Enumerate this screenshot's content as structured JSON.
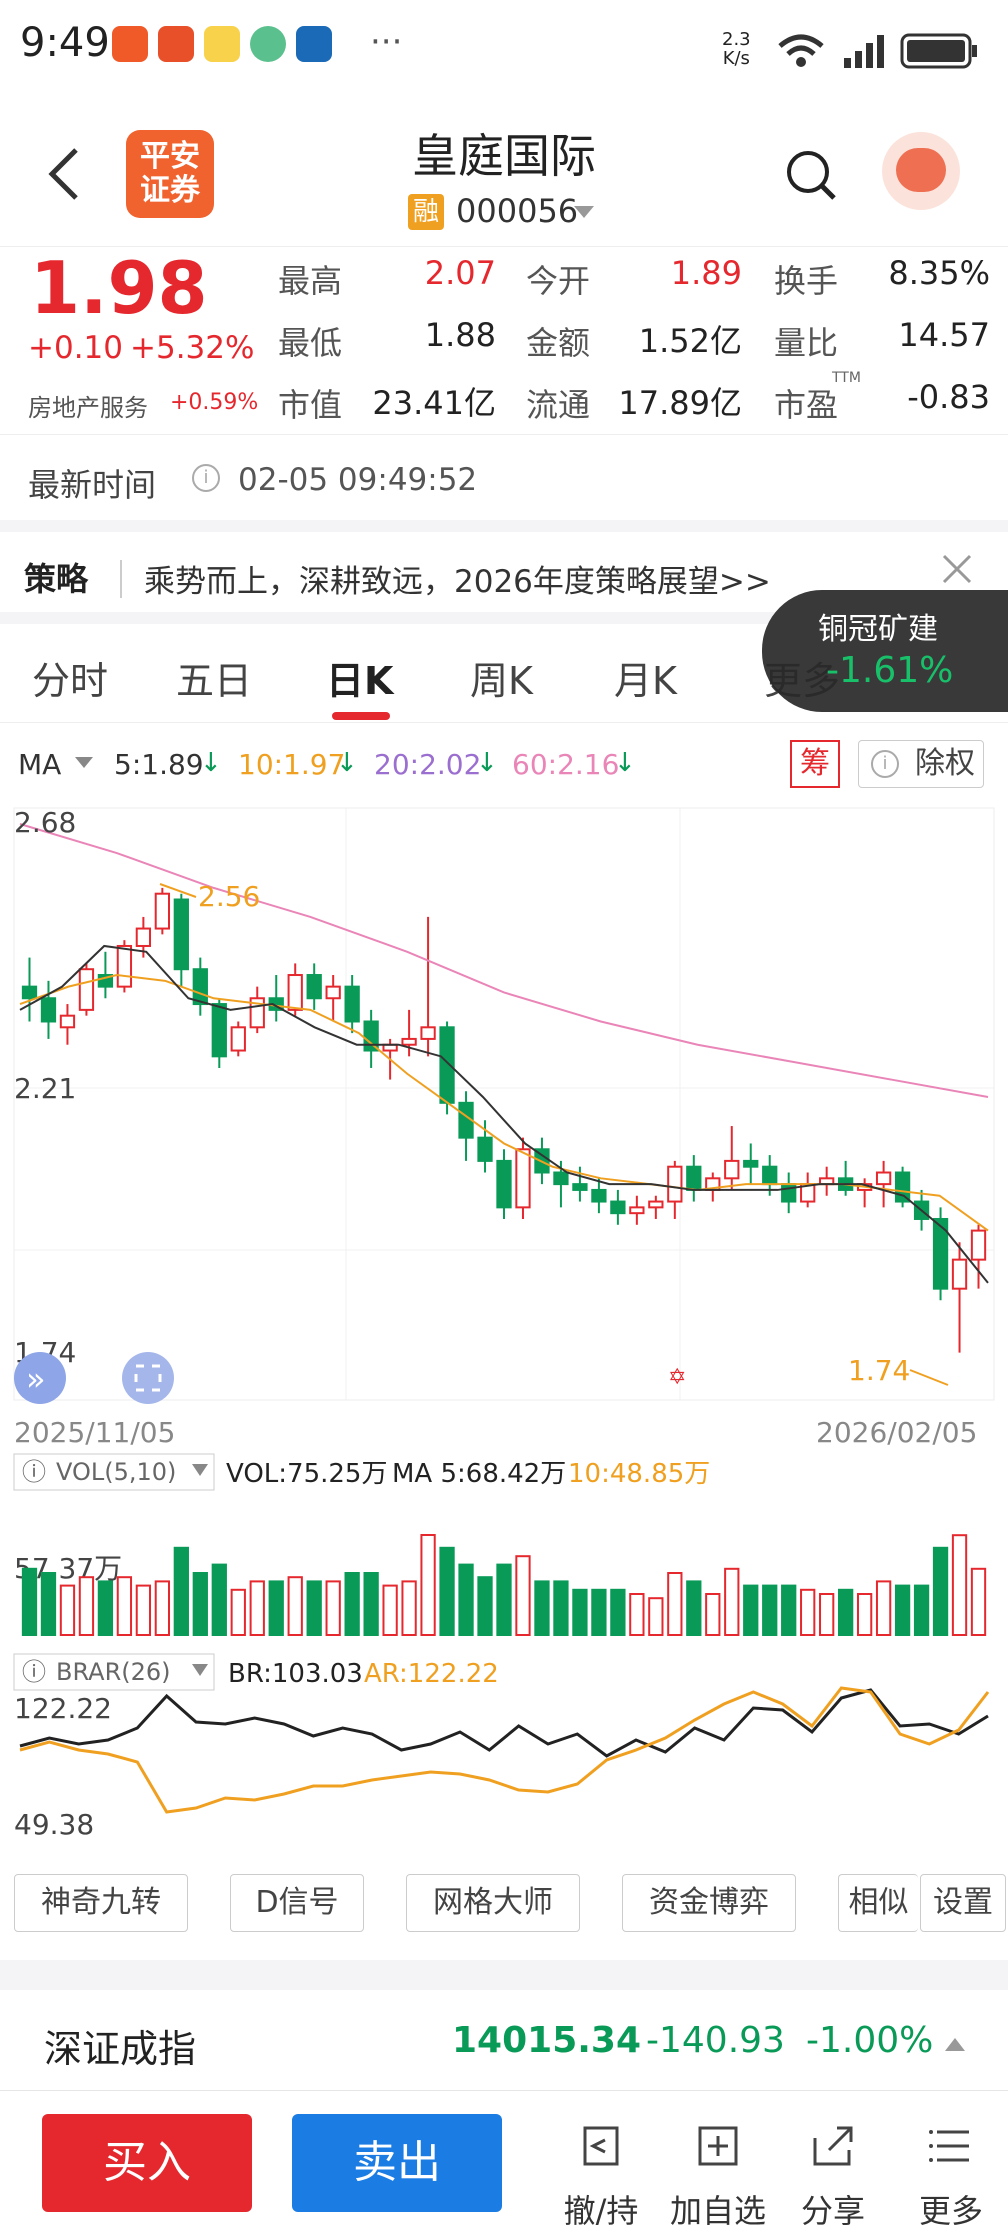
{
  "status": {
    "time": "9:49",
    "net_speed": "2.3\nK/s",
    "more": "···"
  },
  "header": {
    "title": "皇庭国际",
    "margin_badge": "融",
    "code": "000056",
    "broker_logo": "平安\n证券"
  },
  "quote": {
    "price": "1.98",
    "change": "+0.10",
    "change_pct": "+5.32%",
    "sector": "房地产服务",
    "sector_change": "+0.59%",
    "fields": [
      {
        "label": "最高",
        "value": "2.07",
        "color": "red"
      },
      {
        "label": "今开",
        "value": "1.89",
        "color": "red"
      },
      {
        "label": "换手",
        "value": "8.35%",
        "color": "dark"
      },
      {
        "label": "最低",
        "value": "1.88",
        "color": "dark"
      },
      {
        "label": "金额",
        "value": "1.52亿",
        "color": "dark"
      },
      {
        "label": "量比",
        "value": "14.57",
        "color": "dark"
      },
      {
        "label": "市值",
        "value": "23.41亿",
        "color": "dark"
      },
      {
        "label": "流通",
        "value": "17.89亿",
        "color": "dark"
      },
      {
        "label": "市盈",
        "value": "-0.83",
        "color": "dark"
      }
    ],
    "ttm": "TTM"
  },
  "latest_time": {
    "label": "最新时间",
    "value": "02-05 09:49:52"
  },
  "strategy": {
    "label": "策略",
    "text": "乘势而上，深耕致远，2026年度策略展望>>"
  },
  "popup": {
    "name": "铜冠矿建",
    "change": "-1.61%"
  },
  "tabs": [
    "分时",
    "五日",
    "日K",
    "周K",
    "月K",
    "更多"
  ],
  "ma_legend": {
    "label": "MA",
    "ma5": "5:1.89",
    "ma10": "10:1.97",
    "ma20": "20:2.02",
    "ma60": "60:2.16",
    "chip": "筹",
    "exright": "除权"
  },
  "kchart": {
    "y_top": "2.68",
    "y_mid": "2.21",
    "y_bot": "1.74",
    "hi_label": "2.56",
    "lo_label": "1.74",
    "date_start": "2025/11/05",
    "date_end": "2026/02/05"
  },
  "vol": {
    "title": "VOL(5,10)",
    "vol": "VOL:75.25万",
    "ma5": "MA 5:68.42万",
    "ma10": "10:48.85万",
    "axis": "57.37万"
  },
  "brar": {
    "title": "BRAR(26)",
    "br": "BR:103.03",
    "ar": "AR:122.22",
    "axis_top": "122.22",
    "axis_bot": "49.38"
  },
  "tools": [
    "神奇九转",
    "D信号",
    "网格大师",
    "资金博弈",
    "相似",
    "设置"
  ],
  "index": {
    "name": "深证成指",
    "value": "14015.34",
    "change": "-140.93",
    "pct": "-1.00%"
  },
  "bottom": {
    "buy": "买入",
    "sell": "卖出",
    "cancel": "撤/持",
    "add": "加自选",
    "share": "分享",
    "more": "更多"
  },
  "chart_data": {
    "type": "candlestick",
    "title": "皇庭国际",
    "x_range": [
      "2025/11/05",
      "2026/02/05"
    ],
    "ylim": [
      1.74,
      2.68
    ],
    "ohlc": [
      [
        2.4,
        2.45,
        2.34,
        2.38
      ],
      [
        2.38,
        2.41,
        2.31,
        2.34
      ],
      [
        2.33,
        2.37,
        2.3,
        2.35
      ],
      [
        2.36,
        2.44,
        2.35,
        2.43
      ],
      [
        2.42,
        2.46,
        2.38,
        2.4
      ],
      [
        2.4,
        2.48,
        2.39,
        2.47
      ],
      [
        2.47,
        2.52,
        2.45,
        2.5
      ],
      [
        2.5,
        2.57,
        2.49,
        2.56
      ],
      [
        2.55,
        2.56,
        2.4,
        2.43
      ],
      [
        2.43,
        2.45,
        2.35,
        2.37
      ],
      [
        2.37,
        2.38,
        2.26,
        2.28
      ],
      [
        2.29,
        2.34,
        2.28,
        2.33
      ],
      [
        2.33,
        2.4,
        2.32,
        2.38
      ],
      [
        2.38,
        2.42,
        2.34,
        2.36
      ],
      [
        2.36,
        2.44,
        2.35,
        2.42
      ],
      [
        2.42,
        2.44,
        2.36,
        2.38
      ],
      [
        2.38,
        2.42,
        2.34,
        2.4
      ],
      [
        2.4,
        2.42,
        2.32,
        2.34
      ],
      [
        2.34,
        2.36,
        2.26,
        2.29
      ],
      [
        2.29,
        2.31,
        2.24,
        2.3
      ],
      [
        2.3,
        2.36,
        2.28,
        2.31
      ],
      [
        2.31,
        2.52,
        2.28,
        2.33
      ],
      [
        2.33,
        2.34,
        2.18,
        2.2
      ],
      [
        2.2,
        2.22,
        2.1,
        2.14
      ],
      [
        2.14,
        2.17,
        2.08,
        2.1
      ],
      [
        2.1,
        2.12,
        2.0,
        2.02
      ],
      [
        2.02,
        2.14,
        2.0,
        2.12
      ],
      [
        2.12,
        2.14,
        2.06,
        2.08
      ],
      [
        2.08,
        2.1,
        2.02,
        2.06
      ],
      [
        2.06,
        2.09,
        2.03,
        2.05
      ],
      [
        2.05,
        2.07,
        2.01,
        2.03
      ],
      [
        2.03,
        2.05,
        1.99,
        2.01
      ],
      [
        2.01,
        2.04,
        1.99,
        2.02
      ],
      [
        2.02,
        2.04,
        2.0,
        2.03
      ],
      [
        2.03,
        2.1,
        2.0,
        2.09
      ],
      [
        2.09,
        2.11,
        2.03,
        2.05
      ],
      [
        2.05,
        2.08,
        2.03,
        2.07
      ],
      [
        2.07,
        2.16,
        2.05,
        2.1
      ],
      [
        2.1,
        2.13,
        2.06,
        2.09
      ],
      [
        2.09,
        2.11,
        2.04,
        2.06
      ],
      [
        2.06,
        2.08,
        2.01,
        2.03
      ],
      [
        2.03,
        2.08,
        2.02,
        2.06
      ],
      [
        2.06,
        2.09,
        2.04,
        2.07
      ],
      [
        2.07,
        2.1,
        2.04,
        2.05
      ],
      [
        2.05,
        2.07,
        2.02,
        2.06
      ],
      [
        2.06,
        2.1,
        2.02,
        2.08
      ],
      [
        2.08,
        2.09,
        2.02,
        2.03
      ],
      [
        2.03,
        2.05,
        1.98,
        2.0
      ],
      [
        2.0,
        2.02,
        1.86,
        1.88
      ],
      [
        1.88,
        1.96,
        1.77,
        1.93
      ],
      [
        1.93,
        1.99,
        1.88,
        1.98
      ]
    ],
    "ma5": [
      2.36,
      2.4,
      2.47,
      2.46,
      2.38,
      2.36,
      2.37,
      2.33,
      2.3,
      2.3,
      2.28,
      2.21,
      2.13,
      2.08,
      2.06,
      2.06,
      2.05,
      2.05,
      2.05,
      2.06,
      2.06,
      2.04,
      1.98,
      1.89
    ],
    "ma10": [
      2.37,
      2.4,
      2.42,
      2.41,
      2.38,
      2.37,
      2.36,
      2.32,
      2.25,
      2.19,
      2.13,
      2.09,
      2.07,
      2.06,
      2.05,
      2.06,
      2.06,
      2.06,
      2.05,
      2.04,
      1.98
    ],
    "ma60": [
      2.68,
      2.63,
      2.57,
      2.52,
      2.46,
      2.39,
      2.34,
      2.3,
      2.27,
      2.24,
      2.21
    ]
  }
}
